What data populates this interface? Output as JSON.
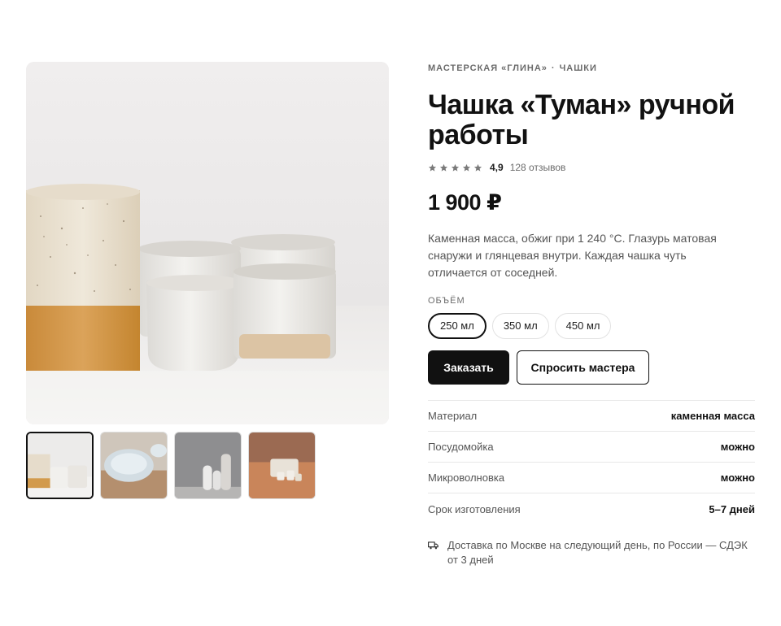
{
  "breadcrumb": {
    "shop": "МАСТЕРСКАЯ «ГЛИНА»",
    "separator": "·",
    "category": "ЧАШКИ"
  },
  "product": {
    "title": "Чашка «Туман» ручной работы",
    "rating": {
      "score": "4,9",
      "stars": 5,
      "reviews": "128 отзывов"
    },
    "price": "1 900 ₽",
    "description": "Каменная масса, обжиг при 1 240 °C. Глазурь матовая снаружи и глянцевая внутри. Каждая чашка чуть отличается от соседней."
  },
  "volume": {
    "label": "ОБЪЁМ",
    "options": [
      {
        "label": "250 мл",
        "selected": true
      },
      {
        "label": "350 мл",
        "selected": false
      },
      {
        "label": "450 мл",
        "selected": false
      }
    ]
  },
  "actions": {
    "order": "Заказать",
    "ask": "Спросить мастера"
  },
  "specs": [
    {
      "key": "Материал",
      "value": "каменная масса"
    },
    {
      "key": "Посудомойка",
      "value": "можно"
    },
    {
      "key": "Микроволновка",
      "value": "можно"
    },
    {
      "key": "Срок изготовления",
      "value": "5–7 дней"
    }
  ],
  "delivery": {
    "text": "Доставка по Москве на следующий день, по России — СДЭК от 3 дней",
    "icon": "truck-icon"
  },
  "gallery": {
    "thumbnails": 4,
    "active_index": 0
  },
  "colors": {
    "accent": "#111111",
    "muted": "#6b6b6b",
    "star": "#7a7a7a",
    "border": "#e8e8e8"
  }
}
